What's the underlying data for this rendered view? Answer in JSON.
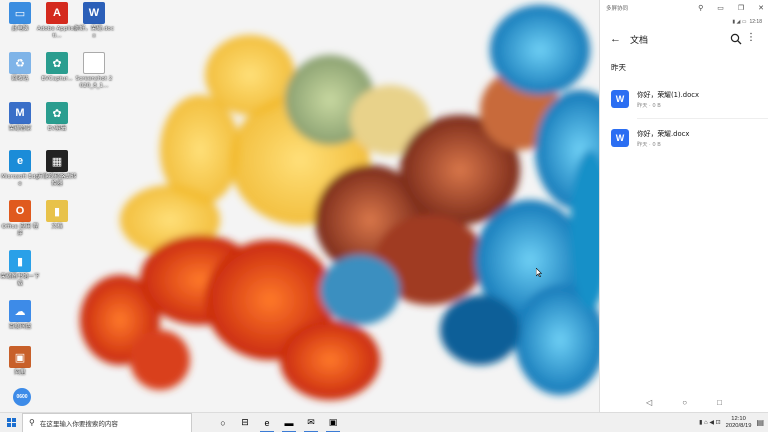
{
  "desktop": {
    "icons": [
      {
        "label": "此电脑",
        "glyph": "▭",
        "color": "#3b8de0"
      },
      {
        "label": "Adobe Applicati...",
        "glyph": "A",
        "color": "#d42a1e"
      },
      {
        "label": "你好，荣耀.docx",
        "glyph": "W",
        "color": "#2b5fb8"
      },
      {
        "label": "回收站",
        "glyph": "♻",
        "color": "#7fb4e8"
      },
      {
        "label": "EVCaptur...",
        "glyph": "✿",
        "color": "#2a9d8f"
      },
      {
        "label": "Screenshot 2020_8_1...",
        "glyph": "",
        "color": "#ffffff"
      },
      {
        "label": "荣耀管家",
        "glyph": "M",
        "color": "#3a6fc8"
      },
      {
        "label": "EV剪辑",
        "glyph": "✿",
        "color": "#2a9d8f"
      },
      {
        "label": "Microsoft Edge",
        "glyph": "e",
        "color": "#1b8cd8"
      },
      {
        "label": "万能视频格式转换器",
        "glyph": "▦",
        "color": "#222222"
      },
      {
        "label": "Office 应用 程序",
        "glyph": "O",
        "color": "#e05a1e"
      },
      {
        "label": "文档",
        "glyph": "▮",
        "color": "#e8c24a"
      },
      {
        "label": "荣耀图书馆一下载",
        "glyph": "▮",
        "color": "#2aa0e8"
      },
      {
        "label": "百度网盘",
        "glyph": "☁",
        "color": "#3d8be8"
      },
      {
        "label": "阿里",
        "glyph": "▣",
        "color": "#c8602a"
      }
    ],
    "badge_label": "0600"
  },
  "phone_window": {
    "title": "多屏协同",
    "controls": [
      "⚲",
      "▭",
      "❐",
      "✕"
    ],
    "status": {
      "icons": "▮ ◢ ▭",
      "time": "12:18"
    },
    "app_bar": {
      "back_glyph": "←",
      "title": "文档",
      "more_glyph": "⋮"
    },
    "section": "昨天",
    "files": [
      {
        "name": "你好，荣耀(1).docx",
        "info": "昨天 · 0 B",
        "icon": "W"
      },
      {
        "name": "你好，荣耀.docx",
        "info": "昨天 · 0 B",
        "icon": "W"
      }
    ],
    "nav": [
      "◁",
      "○",
      "□"
    ]
  },
  "taskbar": {
    "search_placeholder": "在这里输入你要搜索的内容",
    "search_glyph": "⚲",
    "apps": [
      {
        "name": "task-view",
        "glyph": "○"
      },
      {
        "name": "widgets",
        "glyph": "⊟"
      },
      {
        "name": "edge",
        "glyph": "e"
      },
      {
        "name": "file-explorer",
        "glyph": "▬"
      },
      {
        "name": "mail",
        "glyph": "✉"
      },
      {
        "name": "phone-link",
        "glyph": "▣"
      }
    ],
    "tray_icons": "▮ ⌂ ◀ ⊡",
    "time": "12:10",
    "date": "2020/8/19",
    "notification_glyph": "▤"
  }
}
